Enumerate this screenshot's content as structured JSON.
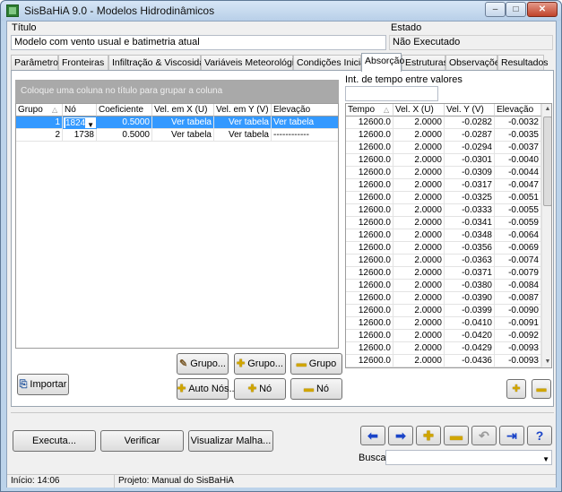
{
  "window": {
    "title": "SisBaHiA 9.0 - Modelos Hidrodinâmicos",
    "minimize_icon": "–",
    "maximize_icon": "□",
    "close_icon": "✕"
  },
  "header": {
    "title_label": "Título",
    "title_value": "Modelo com vento usual e batimetria atual",
    "status_label": "Estado",
    "status_value": "Não Executado"
  },
  "tabs": [
    {
      "label": "Parâmetros"
    },
    {
      "label": "Fronteiras"
    },
    {
      "label": "Infiltração & Viscosidade"
    },
    {
      "label": "Variáveis Meteorológicas"
    },
    {
      "label": "Condições Iniciais"
    },
    {
      "label": "Absorção"
    },
    {
      "label": "Estruturas"
    },
    {
      "label": "Observações"
    },
    {
      "label": "Resultados"
    }
  ],
  "active_tab": "Absorção",
  "absorption": {
    "group_panel_hint": "Coloque uma coluna no título para grupar a coluna",
    "columns": [
      "Grupo",
      "Nó",
      "Coeficiente",
      "Vel. em X (U)",
      "Vel. em Y (V)",
      "Elevação"
    ],
    "sort_icon": "△",
    "dropdown_icon": "▼",
    "rows": [
      {
        "grupo": "1",
        "no": "1824",
        "coef": "0.5000",
        "velx": "Ver tabela",
        "vely": "Ver tabela",
        "elev": "Ver tabela"
      },
      {
        "grupo": "2",
        "no": "1738",
        "coef": "0.5000",
        "velx": "Ver tabela",
        "vely": "Ver tabela",
        "elev": "------------"
      }
    ]
  },
  "time_interval": {
    "label": "Int. de tempo entre valores",
    "value": ""
  },
  "values_table": {
    "columns": [
      "Tempo",
      "Vel. X (U)",
      "Vel. Y (V)",
      "Elevação"
    ],
    "rows": [
      [
        "12600.0",
        "2.0000",
        "-0.0282",
        "-0.0032"
      ],
      [
        "12600.0",
        "2.0000",
        "-0.0287",
        "-0.0035"
      ],
      [
        "12600.0",
        "2.0000",
        "-0.0294",
        "-0.0037"
      ],
      [
        "12600.0",
        "2.0000",
        "-0.0301",
        "-0.0040"
      ],
      [
        "12600.0",
        "2.0000",
        "-0.0309",
        "-0.0044"
      ],
      [
        "12600.0",
        "2.0000",
        "-0.0317",
        "-0.0047"
      ],
      [
        "12600.0",
        "2.0000",
        "-0.0325",
        "-0.0051"
      ],
      [
        "12600.0",
        "2.0000",
        "-0.0333",
        "-0.0055"
      ],
      [
        "12600.0",
        "2.0000",
        "-0.0341",
        "-0.0059"
      ],
      [
        "12600.0",
        "2.0000",
        "-0.0348",
        "-0.0064"
      ],
      [
        "12600.0",
        "2.0000",
        "-0.0356",
        "-0.0069"
      ],
      [
        "12600.0",
        "2.0000",
        "-0.0363",
        "-0.0074"
      ],
      [
        "12600.0",
        "2.0000",
        "-0.0371",
        "-0.0079"
      ],
      [
        "12600.0",
        "2.0000",
        "-0.0380",
        "-0.0084"
      ],
      [
        "12600.0",
        "2.0000",
        "-0.0390",
        "-0.0087"
      ],
      [
        "12600.0",
        "2.0000",
        "-0.0399",
        "-0.0090"
      ],
      [
        "12600.0",
        "2.0000",
        "-0.0410",
        "-0.0091"
      ],
      [
        "12600.0",
        "2.0000",
        "-0.0420",
        "-0.0092"
      ],
      [
        "12600.0",
        "2.0000",
        "-0.0429",
        "-0.0093"
      ],
      [
        "12600.0",
        "2.0000",
        "-0.0436",
        "-0.0093"
      ]
    ]
  },
  "buttons": {
    "importar": "Importar",
    "edit_group": "Grupo...",
    "add_group": "Grupo...",
    "remove_group": "Grupo",
    "auto_nodes": "Auto Nós...",
    "add_node": "Nó",
    "remove_node": "Nó",
    "executa": "Executa...",
    "verificar": "Verificar",
    "visualizar_malha": "Visualizar Malha..."
  },
  "icons": {
    "pencil": "✎",
    "plus": "✚",
    "minus": "▬",
    "import": "⎘",
    "arrow_left": "⬅",
    "arrow_right": "➡",
    "undo": "↶",
    "exit": "⇥",
    "help": "?"
  },
  "search": {
    "label": "Busca:",
    "value": ""
  },
  "statusbar": {
    "start": "Início: 14:06",
    "project": "Projeto: Manual do SisBaHiA"
  }
}
